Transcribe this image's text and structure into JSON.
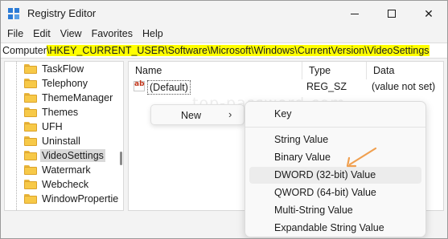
{
  "window": {
    "title": "Registry Editor",
    "minimize_icon": "minimize-icon",
    "maximize_icon": "maximize-icon",
    "close_glyph": "✕"
  },
  "menubar": [
    "File",
    "Edit",
    "View",
    "Favorites",
    "Help"
  ],
  "address": {
    "prefix": "Computer",
    "path": "\\HKEY_CURRENT_USER\\Software\\Microsoft\\Windows\\CurrentVersion\\VideoSettings",
    "highlight_color": "#ffff00"
  },
  "tree": {
    "items": [
      "TaskFlow",
      "Telephony",
      "ThemeManager",
      "Themes",
      "UFH",
      "Uninstall",
      "VideoSettings",
      "Watermark",
      "Webcheck",
      "WindowPropertie"
    ],
    "selected": "VideoSettings"
  },
  "list": {
    "columns": [
      "Name",
      "Type",
      "Data"
    ],
    "rows": [
      {
        "icon": "ab",
        "name": "(Default)",
        "type": "REG_SZ",
        "data": "(value not set)"
      }
    ]
  },
  "watermark": "top-password.com",
  "context_menu": {
    "new_label": "New",
    "new_arrow": "›"
  },
  "submenu": {
    "items": [
      "Key",
      "String Value",
      "Binary Value",
      "DWORD (32-bit) Value",
      "QWORD (64-bit) Value",
      "Multi-String Value",
      "Expandable String Value"
    ],
    "highlighted": "DWORD (32-bit) Value"
  },
  "colors": {
    "accent": "#2b7bd6",
    "folder": "#f7c948",
    "annotation_arrow": "#f0a050"
  }
}
